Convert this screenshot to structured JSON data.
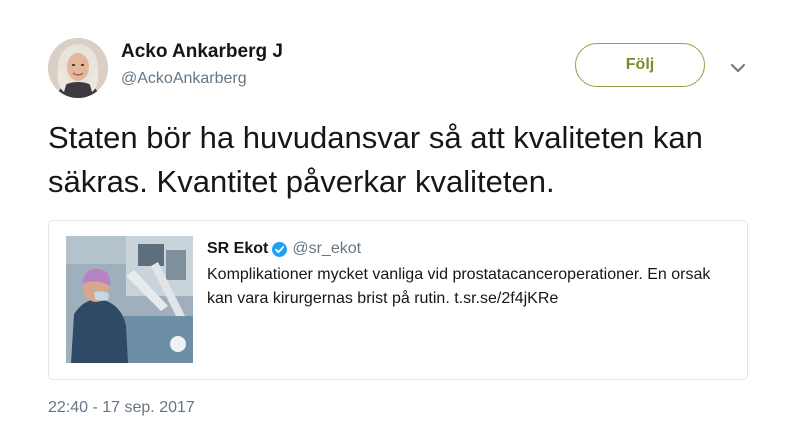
{
  "author": {
    "name": "Acko Ankarberg J",
    "handle": "@AckoAnkarberg",
    "avatar": "profile-photo"
  },
  "follow_button": {
    "label": "Följ",
    "color": "#7a8c30"
  },
  "menu": {
    "icon": "chevron-down-icon"
  },
  "tweet": {
    "text": "Staten bör ha huvudansvar så att kvaliteten kan säkras. Kvantitet påverkar kvaliteten.",
    "timestamp": "22:40 - 17 sep. 2017"
  },
  "quoted_tweet": {
    "name": "SR Ekot",
    "verified": true,
    "verified_icon": "verified-badge-icon",
    "handle": "@sr_ekot",
    "text": "Komplikationer mycket vanliga vid prostatacanceroperationer. En orsak kan vara kirurgernas brist på rutin. t.sr.se/2f4jKRe",
    "media": "surgery-photo"
  },
  "colors": {
    "text": "#14171a",
    "secondary": "#657786",
    "border": "#e1e8ed",
    "verified": "#1da1f2"
  }
}
